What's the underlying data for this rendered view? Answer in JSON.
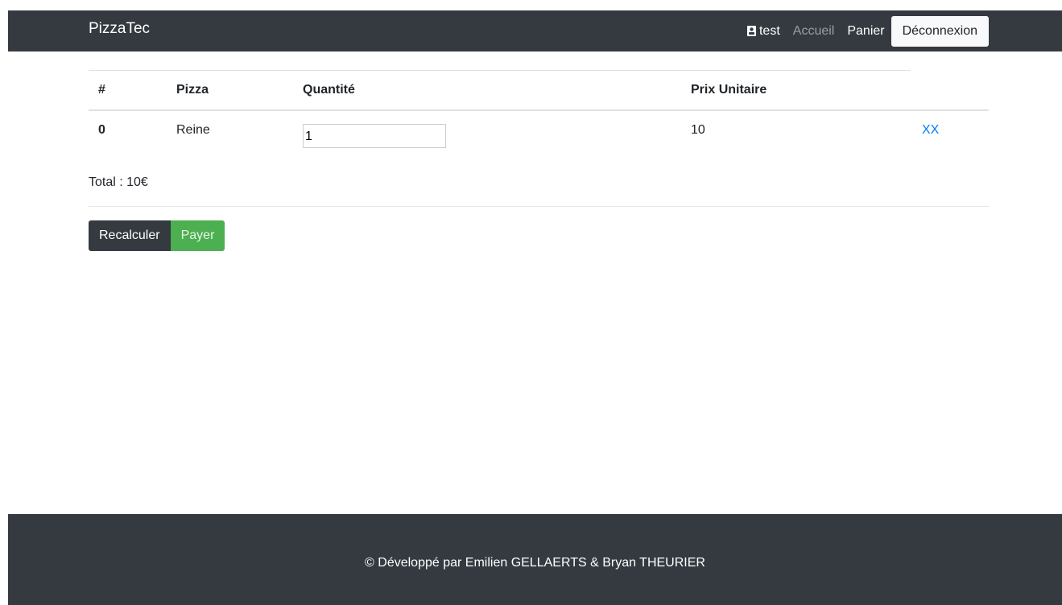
{
  "navbar": {
    "brand": "PizzaTec",
    "user_name": "test",
    "home_link": "Accueil",
    "cart_link": "Panier",
    "logout_button": "Déconnexion",
    "user_icon": "user-badge-icon"
  },
  "cart": {
    "headers": [
      "#",
      "Pizza",
      "Quantité",
      "Prix Unitaire"
    ],
    "rows": [
      {
        "id": "0",
        "pizza": "Reine",
        "quantity": "1",
        "unit_price": "10",
        "remove_label": "XX"
      }
    ],
    "total": "Total : 10€"
  },
  "actions": {
    "recalculate": "Recalculer",
    "pay": "Payer"
  },
  "footer": {
    "text": "© Développé par Emilien GELLAERTS & Bryan THEURIER"
  },
  "colors": {
    "navbar_bg": "#343a40",
    "link_blue": "#007bff",
    "success_green": "#4caf50"
  }
}
